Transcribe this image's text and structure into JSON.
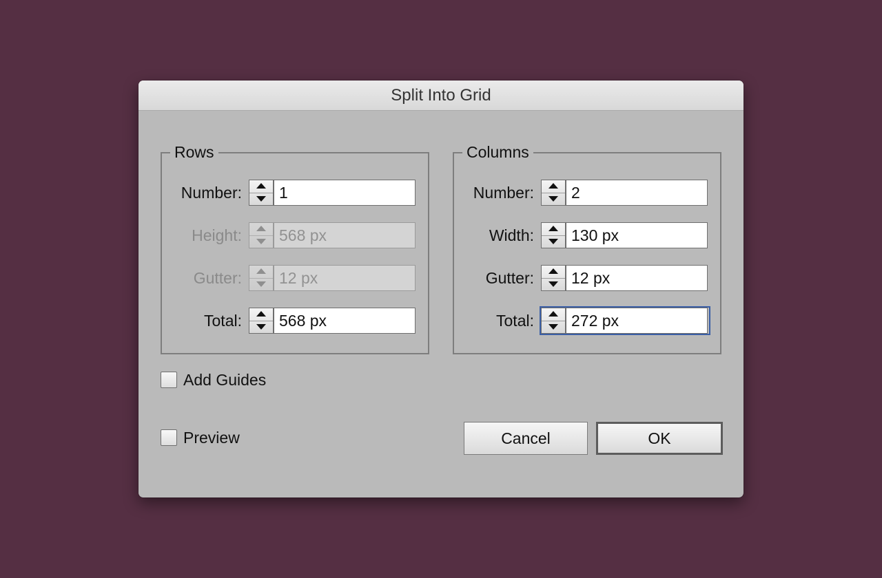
{
  "dialog": {
    "title": "Split Into Grid"
  },
  "rows": {
    "legend": "Rows",
    "fields": [
      {
        "label": "Number:",
        "value": "1",
        "enabled": true
      },
      {
        "label": "Height:",
        "value": "568 px",
        "enabled": false
      },
      {
        "label": "Gutter:",
        "value": "12 px",
        "enabled": false
      },
      {
        "label": "Total:",
        "value": "568 px",
        "enabled": true
      }
    ]
  },
  "columns": {
    "legend": "Columns",
    "fields": [
      {
        "label": "Number:",
        "value": "2",
        "enabled": true
      },
      {
        "label": "Width:",
        "value": "130 px",
        "enabled": true
      },
      {
        "label": "Gutter:",
        "value": "12 px",
        "enabled": true
      },
      {
        "label": "Total:",
        "value": "272 px",
        "enabled": true,
        "focused": true
      }
    ]
  },
  "options": {
    "add_guides": {
      "label": "Add Guides",
      "checked": false
    },
    "preview": {
      "label": "Preview",
      "checked": false
    }
  },
  "buttons": {
    "cancel": "Cancel",
    "ok": "OK"
  },
  "colors": {
    "background": "#552f43",
    "dialog": "#bababa",
    "focus": "#3b5fa6"
  }
}
